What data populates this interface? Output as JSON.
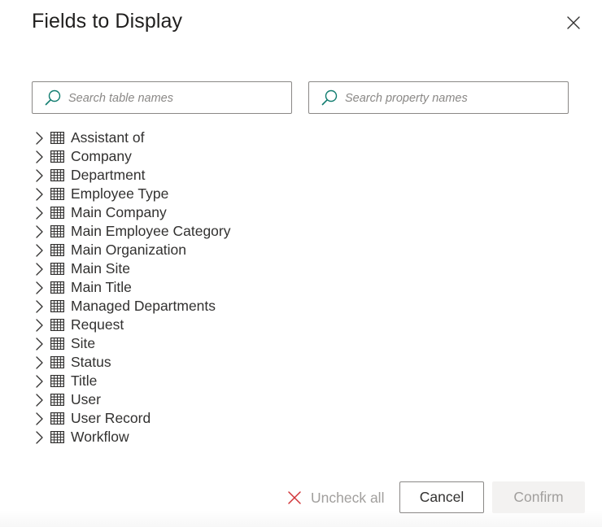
{
  "dialog": {
    "title": "Fields to Display",
    "close_icon": "close-icon"
  },
  "search": {
    "tables_placeholder": "Search table names",
    "tables_value": "",
    "properties_placeholder": "Search property names",
    "properties_value": "",
    "icon": "search-icon"
  },
  "tree": {
    "expand_icon": "chevron-right-icon",
    "item_icon": "table-icon",
    "items": [
      {
        "label": "Assistant of"
      },
      {
        "label": "Company"
      },
      {
        "label": "Department"
      },
      {
        "label": "Employee Type"
      },
      {
        "label": "Main Company"
      },
      {
        "label": "Main Employee Category"
      },
      {
        "label": "Main Organization"
      },
      {
        "label": "Main Site"
      },
      {
        "label": "Main Title"
      },
      {
        "label": "Managed Departments"
      },
      {
        "label": "Request"
      },
      {
        "label": "Site"
      },
      {
        "label": "Status"
      },
      {
        "label": "Title"
      },
      {
        "label": "User"
      },
      {
        "label": "User Record"
      },
      {
        "label": "Workflow"
      }
    ]
  },
  "footer": {
    "uncheck_all_label": "Uncheck all",
    "uncheck_all_icon": "x-icon",
    "uncheck_all_icon_color": "#d13438",
    "cancel_label": "Cancel",
    "confirm_label": "Confirm",
    "confirm_disabled": true
  },
  "colors": {
    "search_icon": "#107c6f",
    "text_primary": "#323130",
    "text_disabled": "#a19f9d",
    "border": "#8a8886"
  }
}
